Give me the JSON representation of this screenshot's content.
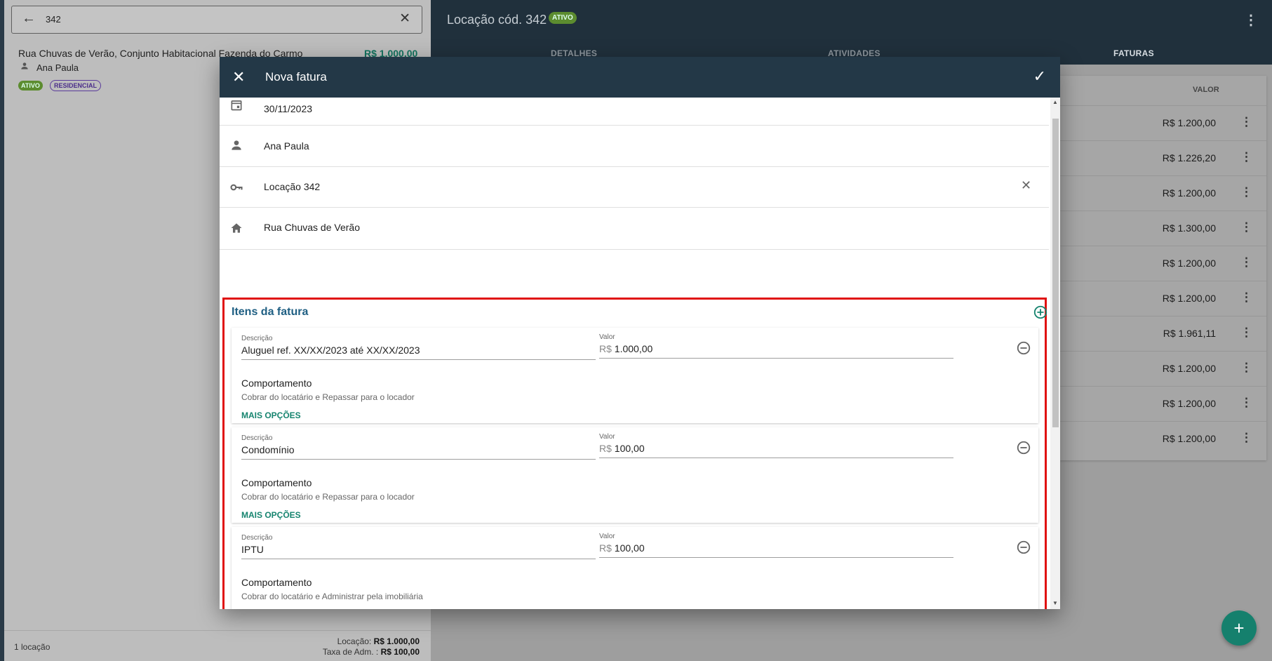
{
  "search": {
    "value": "342"
  },
  "result": {
    "address": "Rua Chuvas de Verão, Conjunto Habitacional Fazenda do Carmo",
    "price": "R$ 1.000,00",
    "person": "Ana Paula",
    "badges": [
      "ATIVO",
      "RESIDENCIAL"
    ]
  },
  "footer": {
    "count": "1 locação",
    "locacao_label": "Locação:",
    "locacao_value": "R$ 1.000,00",
    "taxa_label": "Taxa de Adm. :",
    "taxa_value": "R$ 100,00"
  },
  "detail": {
    "title": "Locação cód. 342",
    "status": "ATIVO",
    "tabs": [
      "DETALHES",
      "ATIVIDADES",
      "FATURAS"
    ],
    "active_tab": "FATURAS",
    "valor_header": "VALOR",
    "rows": [
      "R$ 1.200,00",
      "R$ 1.226,20",
      "R$ 1.200,00",
      "R$ 1.300,00",
      "R$ 1.200,00",
      "R$ 1.200,00",
      "R$ 1.961,11",
      "R$ 1.200,00",
      "R$ 1.200,00",
      "R$ 1.200,00"
    ]
  },
  "dialog": {
    "title": "Nova fatura",
    "date": "30/11/2023",
    "person": "Ana Paula",
    "contract": "Locação 342",
    "property": "Rua Chuvas de Verão",
    "items_title": "Itens da fatura",
    "desc_label": "Descrição",
    "valor_label": "Valor",
    "currency": "R$",
    "behavior_label": "Comportamento",
    "more_label": "MAIS OPÇÕES",
    "items": [
      {
        "description": "Aluguel ref. XX/XX/2023 até XX/XX/2023",
        "value": "1.000,00",
        "behavior": "Cobrar do locatário e Repassar para o locador"
      },
      {
        "description": "Condomínio",
        "value": "100,00",
        "behavior": "Cobrar do locatário e Repassar para o locador"
      },
      {
        "description": "IPTU",
        "value": "100,00",
        "behavior": "Cobrar do locatário e Administrar pela imobiliária"
      }
    ]
  },
  "colors": {
    "header": "#233847",
    "accent": "#16846f",
    "highlight": "#e01010"
  },
  "icons": [
    "arrow-left-icon",
    "close-icon",
    "person-icon",
    "more-vert-icon",
    "check-icon",
    "calendar-icon",
    "key-icon",
    "home-icon",
    "add-circle-icon",
    "remove-circle-icon",
    "add-icon"
  ]
}
